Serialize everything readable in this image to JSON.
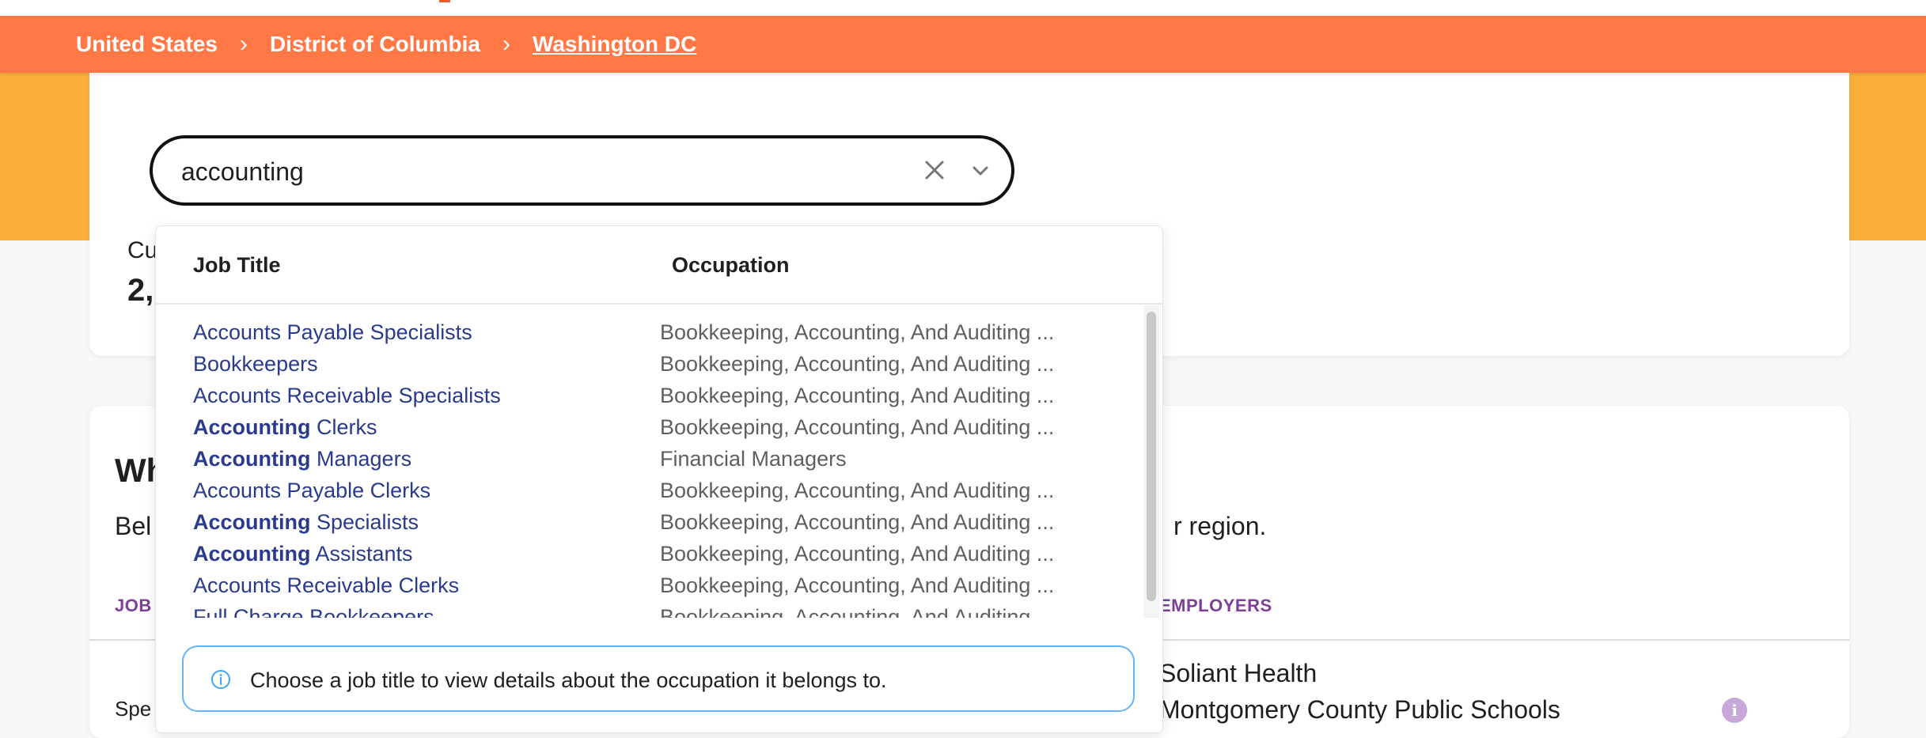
{
  "breadcrumb": {
    "items": [
      {
        "label": "United States"
      },
      {
        "label": "District of Columbia"
      },
      {
        "label": "Washington DC"
      }
    ]
  },
  "search": {
    "value": "accounting"
  },
  "summary_card": {
    "label_partial": "Cu",
    "value_partial": "2,"
  },
  "section": {
    "heading_partial": "Wh",
    "desc_left": "Bel",
    "desc_right": "r region.",
    "col_job": "JOB",
    "col_employers": "EMPLOYERS",
    "row_left": "Spe",
    "employers": [
      "Soliant Health",
      "Montgomery County Public Schools"
    ]
  },
  "dropdown": {
    "headers": {
      "job_title": "Job Title",
      "occupation": "Occupation"
    },
    "rows": [
      {
        "bold": "",
        "rest": "Accounts Payable Specialists",
        "occupation": "Bookkeeping, Accounting, And Auditing ..."
      },
      {
        "bold": "",
        "rest": "Bookkeepers",
        "occupation": "Bookkeeping, Accounting, And Auditing ..."
      },
      {
        "bold": "",
        "rest": "Accounts Receivable Specialists",
        "occupation": "Bookkeeping, Accounting, And Auditing ..."
      },
      {
        "bold": "Accounting",
        "rest": " Clerks",
        "occupation": "Bookkeeping, Accounting, And Auditing ..."
      },
      {
        "bold": "Accounting",
        "rest": " Managers",
        "occupation": "Financial Managers"
      },
      {
        "bold": "",
        "rest": "Accounts Payable Clerks",
        "occupation": "Bookkeeping, Accounting, And Auditing ..."
      },
      {
        "bold": "Accounting",
        "rest": " Specialists",
        "occupation": "Bookkeeping, Accounting, And Auditing ..."
      },
      {
        "bold": "Accounting",
        "rest": " Assistants",
        "occupation": "Bookkeeping, Accounting, And Auditing ..."
      },
      {
        "bold": "",
        "rest": "Accounts Receivable Clerks",
        "occupation": "Bookkeeping, Accounting, And Auditing ..."
      },
      {
        "bold": "",
        "rest": "Full Charge Bookkeepers",
        "occupation": "Bookkeeping, Accounting, And Auditing ..."
      }
    ],
    "info_message": "Choose a job title to view details about the occupation it belongs to."
  },
  "colors": {
    "breadcrumb_bg": "#ff7846",
    "band": "#fbb03b",
    "link": "#2a3a8c",
    "accent_purple": "#7d3f98",
    "info_border": "#64b5f6"
  }
}
